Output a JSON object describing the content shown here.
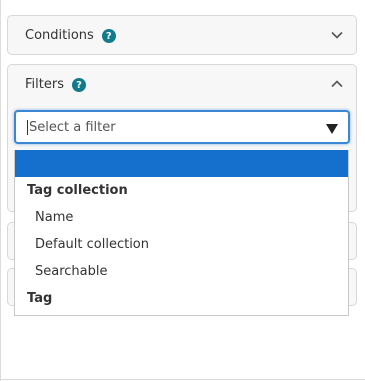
{
  "panels": [
    {
      "title": "Conditions",
      "help": "?",
      "expanded": false
    },
    {
      "title": "Filters",
      "help": "?",
      "expanded": true
    }
  ],
  "filter_select": {
    "placeholder": "Select a filter",
    "options": [
      {
        "type": "option",
        "label": "",
        "highlighted": true
      },
      {
        "type": "group",
        "label": "Tag collection"
      },
      {
        "type": "option",
        "label": "Name"
      },
      {
        "type": "option",
        "label": "Default collection"
      },
      {
        "type": "option",
        "label": "Searchable"
      },
      {
        "type": "group",
        "label": "Tag"
      }
    ]
  },
  "colors": {
    "accent": "#1470cc",
    "help_icon": "#0f7c8c",
    "focus_border": "#3b87d4"
  }
}
